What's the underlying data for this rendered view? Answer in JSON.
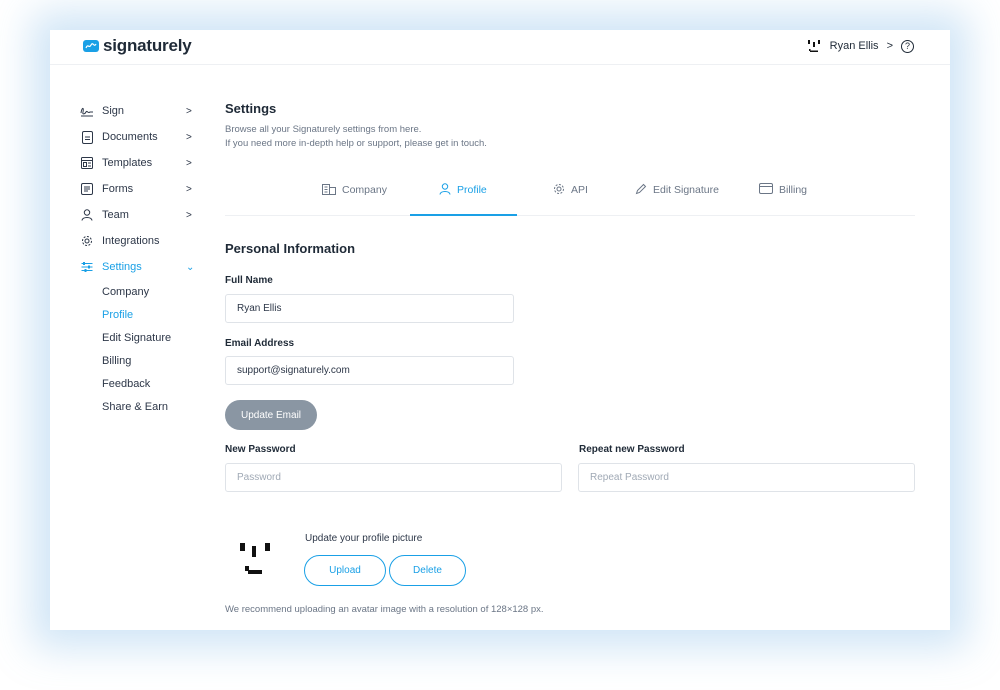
{
  "header": {
    "brand": "signaturely",
    "user_name": "Ryan Ellis",
    "user_chevron": ">",
    "help_glyph": "?"
  },
  "sidebar": {
    "items": [
      {
        "label": "Sign",
        "icon": "sign-icon",
        "chevron": ">"
      },
      {
        "label": "Documents",
        "icon": "document-icon",
        "chevron": ">"
      },
      {
        "label": "Templates",
        "icon": "templates-icon",
        "chevron": ">"
      },
      {
        "label": "Forms",
        "icon": "forms-icon",
        "chevron": ">"
      },
      {
        "label": "Team",
        "icon": "team-icon",
        "chevron": ">"
      },
      {
        "label": "Integrations",
        "icon": "integrations-icon"
      },
      {
        "label": "Settings",
        "icon": "settings-sliders-icon",
        "chevron": "⌄",
        "active": true
      }
    ],
    "subitems": [
      {
        "label": "Company"
      },
      {
        "label": "Profile",
        "active": true
      },
      {
        "label": "Edit Signature"
      },
      {
        "label": "Billing"
      },
      {
        "label": "Feedback"
      },
      {
        "label": "Share & Earn"
      }
    ]
  },
  "main": {
    "title": "Settings",
    "desc_line1": "Browse all your Signaturely settings from here.",
    "desc_line2": "If you need more in-depth help or support, please get in touch.",
    "tabs": [
      {
        "label": "Company",
        "icon": "building-icon"
      },
      {
        "label": "Profile",
        "icon": "user-icon",
        "active": true
      },
      {
        "label": "API",
        "icon": "gear-icon"
      },
      {
        "label": "Edit Signature",
        "icon": "pencil-icon"
      },
      {
        "label": "Billing",
        "icon": "card-icon"
      }
    ],
    "section_title": "Personal Information",
    "full_name_label": "Full Name",
    "full_name_value": "Ryan Ellis",
    "email_label": "Email Address",
    "email_value": "support@signaturely.com",
    "update_email_button": "Update Email",
    "new_password_label": "New Password",
    "new_password_placeholder": "Password",
    "repeat_password_label": "Repeat new Password",
    "repeat_password_placeholder": "Repeat Password",
    "picture_label": "Update your profile picture",
    "upload_button": "Upload",
    "delete_button": "Delete",
    "recommend_text": "We recommend uploading an avatar image with a resolution of 128×128 px."
  },
  "colors": {
    "accent": "#1aa0e6",
    "disabled_button": "#8a96a3",
    "text_dark": "#1f2a37",
    "text_muted": "#6b7686"
  }
}
